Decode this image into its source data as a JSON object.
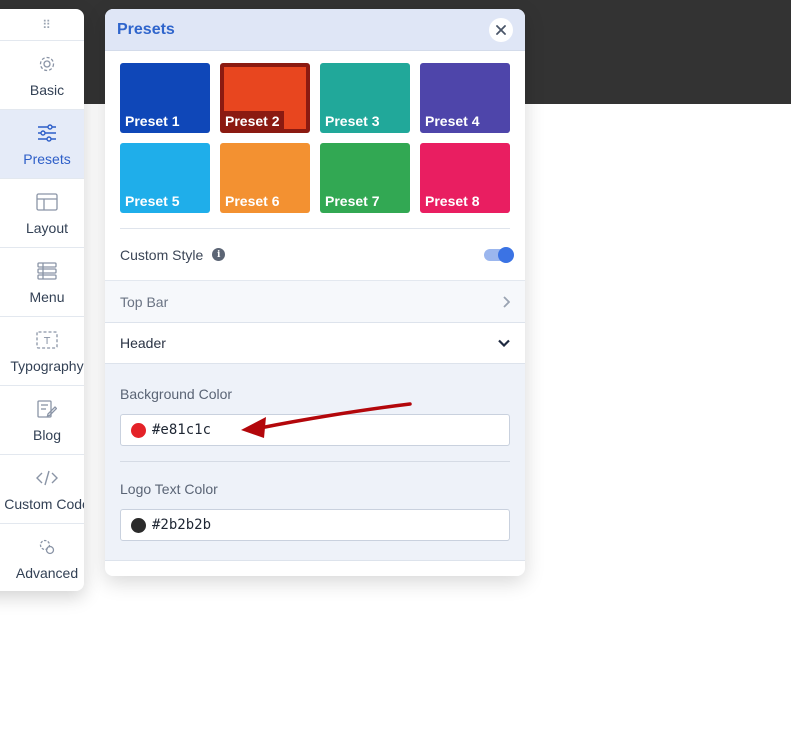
{
  "sidebar": {
    "handle": "⠿",
    "items": [
      {
        "label": "Basic",
        "icon": "gear-icon"
      },
      {
        "label": "Presets",
        "icon": "sliders-icon"
      },
      {
        "label": "Layout",
        "icon": "layout-icon"
      },
      {
        "label": "Menu",
        "icon": "menu-icon"
      },
      {
        "label": "Typography",
        "icon": "typography-icon"
      },
      {
        "label": "Blog",
        "icon": "edit-icon"
      },
      {
        "label": "Custom Code",
        "icon": "code-icon"
      },
      {
        "label": "Advanced",
        "icon": "advanced-icon"
      }
    ],
    "active_index": 1
  },
  "panel": {
    "title": "Presets",
    "presets": [
      {
        "name": "Preset 1",
        "color": "#0f47b8"
      },
      {
        "name": "Preset 2",
        "color": "#e8461f",
        "selected": true
      },
      {
        "name": "Preset 3",
        "color": "#21a89a"
      },
      {
        "name": "Preset 4",
        "color": "#4e45aa"
      },
      {
        "name": "Preset 5",
        "color": "#1faeea"
      },
      {
        "name": "Preset 6",
        "color": "#f39131"
      },
      {
        "name": "Preset 7",
        "color": "#32a853"
      },
      {
        "name": "Preset 8",
        "color": "#e91e61"
      }
    ],
    "custom_style": {
      "label": "Custom Style",
      "info": "i",
      "enabled": true
    },
    "top_bar": {
      "label": "Top Bar"
    },
    "header": {
      "label": "Header"
    },
    "background_color": {
      "label": "Background Color",
      "value": "#e81c1c",
      "swatch": "#e42228"
    },
    "logo_text_color": {
      "label": "Logo Text Color",
      "value": "#2b2b2b",
      "swatch": "#2b2b2b"
    }
  },
  "annotation": {
    "arrow_color": "#b3070b"
  }
}
